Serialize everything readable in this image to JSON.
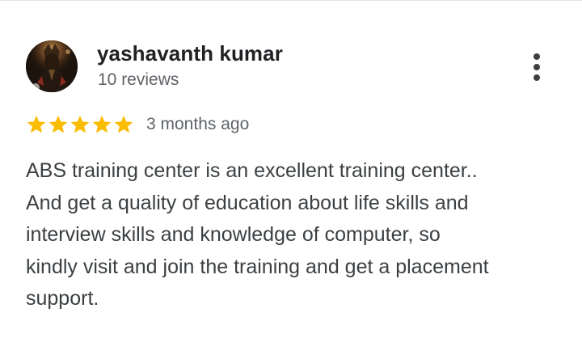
{
  "review": {
    "reviewer": {
      "name": "yashavanth kumar",
      "meta": "10 reviews",
      "avatar_icon": "profile-photo-avatar"
    },
    "menu_icon": "more-vert-icon",
    "rating": {
      "stars": 5,
      "max_stars": 5,
      "star_color": "#fbbc04",
      "date": "3 months ago"
    },
    "text": "ABS training center is an excellent training center..\nAnd get a quality of education about life skills and\ninterview skills and knowledge of computer, so\nkindly visit and join the training and get a placement\nsupport."
  }
}
